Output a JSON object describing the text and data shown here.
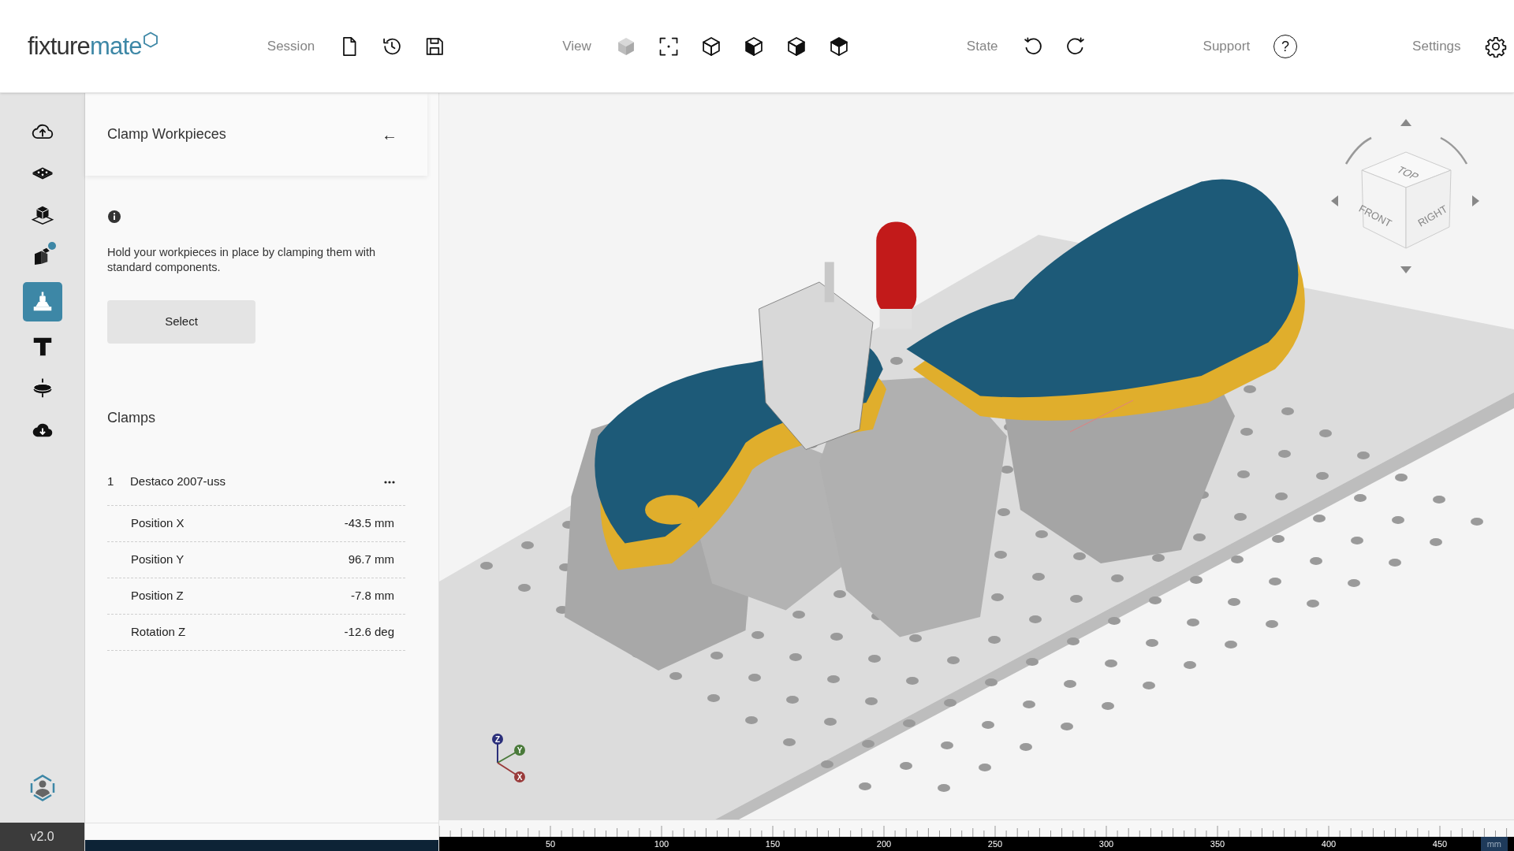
{
  "header": {
    "logo": {
      "part_1": "fixture",
      "part_2": "mate"
    },
    "groups": [
      {
        "kind": "session",
        "label": "Session"
      },
      {
        "kind": "view",
        "label": "View"
      },
      {
        "kind": "state",
        "label": "State"
      },
      {
        "kind": "support",
        "label": "Support",
        "glyph": "?"
      },
      {
        "kind": "settings",
        "label": "Settings"
      }
    ]
  },
  "sidebar": {
    "items": [
      {
        "selected": false,
        "badge": false
      },
      {
        "selected": false,
        "badge": false
      },
      {
        "selected": false,
        "badge": false
      },
      {
        "selected": false,
        "badge": true
      },
      {
        "selected": true,
        "badge": false
      },
      {
        "selected": false,
        "badge": false
      },
      {
        "selected": false,
        "badge": false
      },
      {
        "selected": false,
        "badge": false
      }
    ],
    "version": "v2.0"
  },
  "panel": {
    "title": "Clamp Workpieces",
    "back": "←",
    "description": "Hold your workpieces in place by clamping them with standard components.",
    "select_button": "Select",
    "section_title": "Clamps",
    "clamps": [
      {
        "index": "1",
        "name": "Destaco 2007-uss",
        "properties": [
          {
            "label": "Position X",
            "value": "-43.5 mm"
          },
          {
            "label": "Position Y",
            "value": "96.7 mm"
          },
          {
            "label": "Position Z",
            "value": "-7.8 mm"
          },
          {
            "label": "Rotation Z",
            "value": "-12.6 deg"
          }
        ]
      }
    ]
  },
  "viewport": {
    "view_cube": {
      "faces": [
        {
          "kind": "top",
          "label": "TOP"
        },
        {
          "kind": "front",
          "label": "FRONT"
        },
        {
          "kind": "right",
          "label": "RIGHT"
        }
      ]
    },
    "axes": [
      {
        "label": "Z",
        "color": "#2b2f7a"
      },
      {
        "label": "Y",
        "color": "#4a7a3a"
      },
      {
        "label": "X",
        "color": "#9a3b3b"
      }
    ],
    "ruler": {
      "labels": [
        "50",
        "100",
        "150",
        "200",
        "250",
        "300",
        "350",
        "400",
        "450"
      ],
      "unit": "mm"
    }
  }
}
